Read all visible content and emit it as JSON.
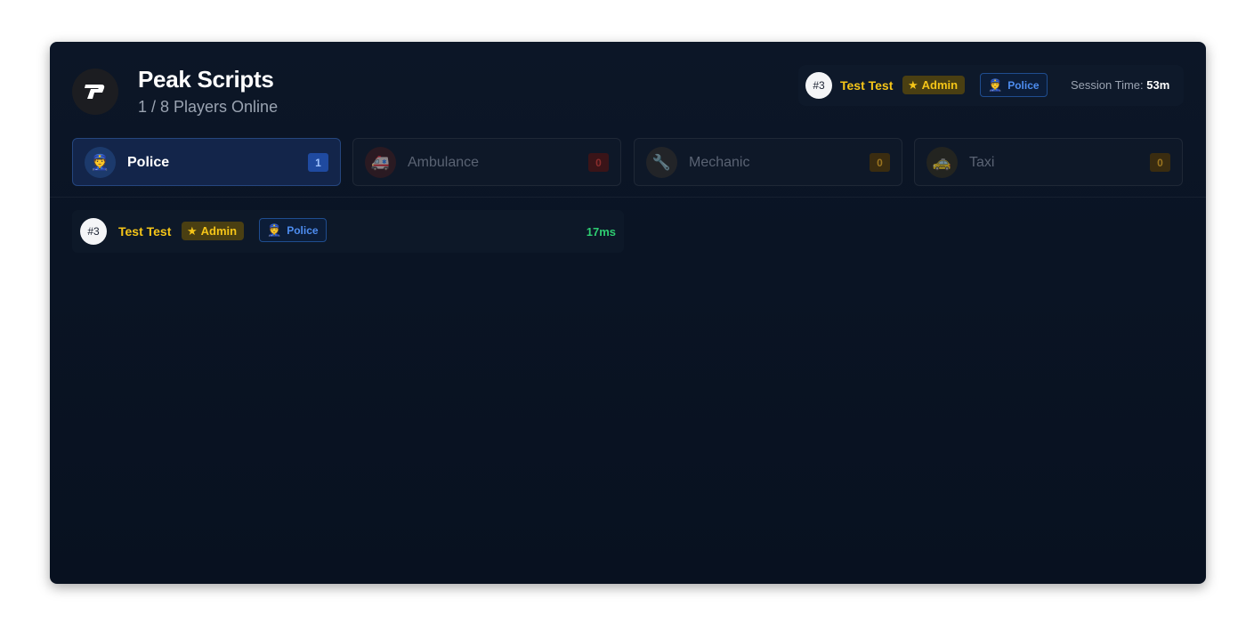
{
  "header": {
    "title": "Peak Scripts",
    "subtitle": "1 / 8 Players Online"
  },
  "current_player": {
    "rank": "#3",
    "name": "Test Test",
    "role": "Admin",
    "job": "Police",
    "session_label": "Session Time:",
    "session_value": "53m"
  },
  "tabs": [
    {
      "label": "Police",
      "count": "1",
      "icon": "police-officer-icon",
      "active": true,
      "color": "#4e8df0"
    },
    {
      "label": "Ambulance",
      "count": "0",
      "icon": "ambulance-icon",
      "active": false,
      "color": "#e04646"
    },
    {
      "label": "Mechanic",
      "count": "0",
      "icon": "wrench-icon",
      "active": false,
      "color": "#d89a2a"
    },
    {
      "label": "Taxi",
      "count": "0",
      "icon": "taxi-icon",
      "active": false,
      "color": "#d89a2a"
    }
  ],
  "players": [
    {
      "rank": "#3",
      "name": "Test Test",
      "role": "Admin",
      "job": "Police",
      "ping": "17ms"
    }
  ],
  "colors": {
    "background": "#0a1424",
    "accent_gold": "#f5c518",
    "accent_blue": "#4e8df0",
    "ping_green": "#2ecc71"
  }
}
